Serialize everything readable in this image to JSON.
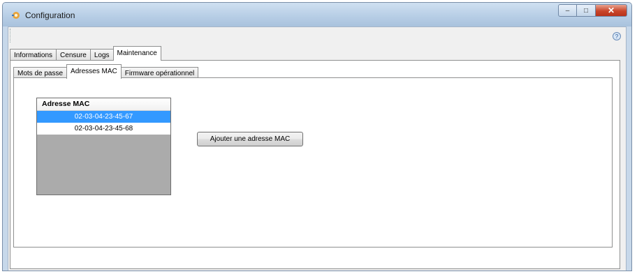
{
  "window": {
    "title": "Configuration",
    "caption_buttons": {
      "minimize": "–",
      "maximize": "□",
      "close": "✕"
    }
  },
  "main_tabs": [
    {
      "label": "Informations",
      "active": false
    },
    {
      "label": "Censure",
      "active": false
    },
    {
      "label": "Logs",
      "active": false
    },
    {
      "label": "Maintenance",
      "active": true
    }
  ],
  "sub_tabs": [
    {
      "label": "Mots de passe",
      "active": false
    },
    {
      "label": "Adresses MAC",
      "active": true
    },
    {
      "label": "Firmware opérationnel",
      "active": false
    }
  ],
  "mac_list": {
    "header": "Adresse MAC",
    "rows": [
      {
        "value": "02-03-04-23-45-67",
        "selected": true
      },
      {
        "value": "02-03-04-23-45-68",
        "selected": false
      }
    ]
  },
  "add_mac_button": "Ajouter une adresse MAC",
  "colors": {
    "selection": "#3399ff",
    "list_empty_area": "#ababab",
    "close_button": "#c9452a"
  }
}
